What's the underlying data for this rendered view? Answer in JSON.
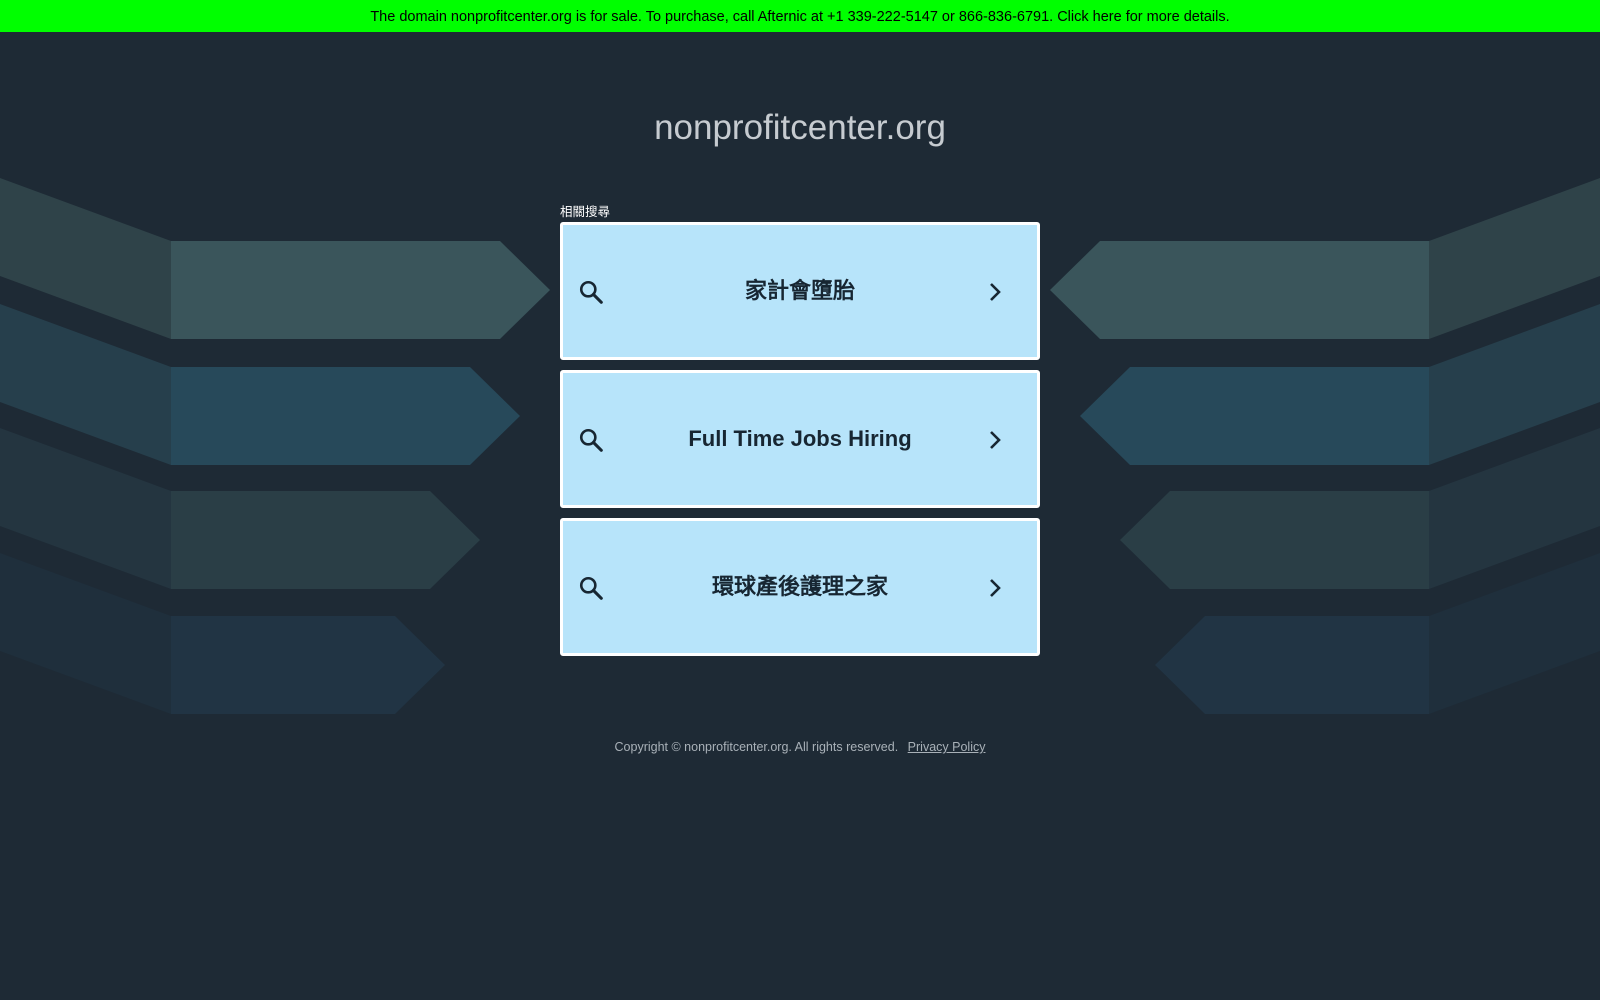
{
  "banner": {
    "text": "The domain nonprofitcenter.org is for sale. To purchase, call Afternic at +1 339-222-5147 or 866-836-6791. Click here for more details."
  },
  "header": {
    "domain": "nonprofitcenter.org"
  },
  "related": {
    "label": "相關搜尋",
    "items": [
      {
        "label": "家計會墮胎",
        "icon": "search-icon"
      },
      {
        "label": "Full Time Jobs Hiring",
        "icon": "search-icon"
      },
      {
        "label": "環球產後護理之家",
        "icon": "search-icon"
      }
    ]
  },
  "footer": {
    "copyright": "Copyright © nonprofitcenter.org.  All rights reserved.",
    "privacy_label": "Privacy Policy"
  },
  "colors": {
    "background": "#1e2a35",
    "banner": "#00ff00",
    "card": "#b7e4fa",
    "card_border": "#ffffff",
    "card_text": "#172632"
  }
}
